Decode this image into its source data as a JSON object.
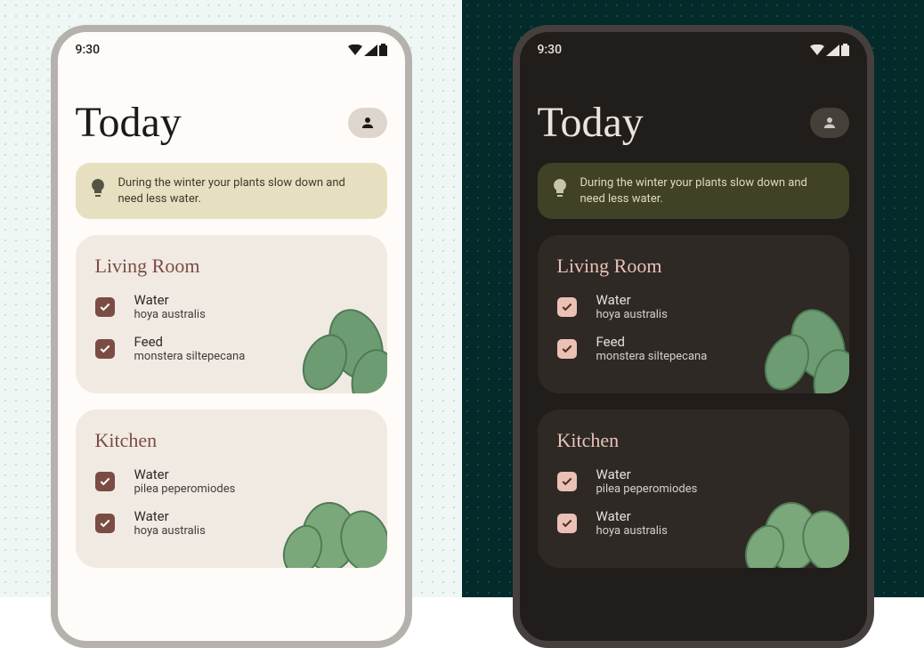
{
  "status": {
    "time": "9:30"
  },
  "header": {
    "title": "Today"
  },
  "tip": {
    "text": "During the winter your plants slow down and need less water."
  },
  "rooms": [
    {
      "name": "Living Room",
      "tasks": [
        {
          "label": "Water",
          "sub": "hoya australis",
          "done": true
        },
        {
          "label": "Feed",
          "sub": "monstera siltepecana",
          "done": true
        }
      ]
    },
    {
      "name": "Kitchen",
      "tasks": [
        {
          "label": "Water",
          "sub": "pilea peperomiodes",
          "done": true
        },
        {
          "label": "Water",
          "sub": "hoya australis",
          "done": true
        }
      ]
    }
  ],
  "variants": [
    "light",
    "dark"
  ]
}
